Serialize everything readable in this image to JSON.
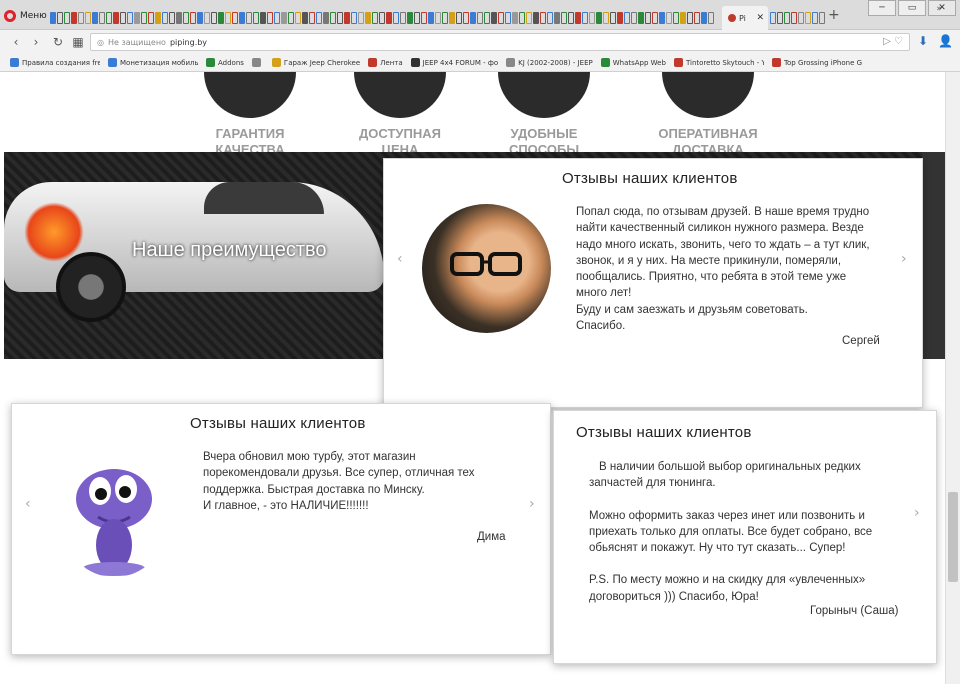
{
  "browser": {
    "menu_label": "Меню",
    "active_tab_label": "Pi",
    "url_security": "Не защищено",
    "url": "piping.by",
    "tab_colors": [
      "#3a7bd5",
      "#5a5a5a",
      "#2a8a3a",
      "#c0392b",
      "#888",
      "#d4a017",
      "#3a7bd5",
      "#777",
      "#2a8a3a",
      "#c0392b",
      "#555",
      "#3a7bd5",
      "#999",
      "#2a8a3a",
      "#c0392b",
      "#d4a017",
      "#3a7bd5",
      "#555",
      "#777",
      "#2a8a3a",
      "#c0392b",
      "#3a7bd5",
      "#999",
      "#555",
      "#2a8a3a",
      "#d4a017",
      "#c0392b",
      "#3a7bd5",
      "#777",
      "#2a8a3a",
      "#555",
      "#c0392b",
      "#3a7bd5",
      "#999",
      "#2a8a3a",
      "#d4a017",
      "#555",
      "#c0392b",
      "#3a7bd5",
      "#777",
      "#2a8a3a",
      "#555",
      "#c0392b",
      "#3a7bd5",
      "#999",
      "#d4a017",
      "#2a8a3a",
      "#555",
      "#c0392b",
      "#3a7bd5",
      "#777",
      "#2a8a3a",
      "#555",
      "#c0392b",
      "#3a7bd5",
      "#999",
      "#2a8a3a",
      "#d4a017",
      "#555",
      "#c0392b",
      "#3a7bd5",
      "#777",
      "#2a8a3a",
      "#555",
      "#c0392b",
      "#3a7bd5",
      "#999",
      "#2a8a3a",
      "#d4a017",
      "#555",
      "#c0392b",
      "#3a7bd5",
      "#777",
      "#2a8a3a",
      "#555",
      "#c0392b",
      "#3a7bd5",
      "#999",
      "#2a8a3a",
      "#d4a017",
      "#555",
      "#c0392b",
      "#3a7bd5",
      "#777",
      "#2a8a3a",
      "#555",
      "#c0392b",
      "#3a7bd5",
      "#999",
      "#2a8a3a",
      "#d4a017",
      "#555",
      "#c0392b",
      "#3a7bd5",
      "#777"
    ]
  },
  "bookmarks": [
    {
      "label": "Правила создания fre",
      "color": "#3a7bd5"
    },
    {
      "label": "Монетизация мобиль",
      "color": "#3a7bd5"
    },
    {
      "label": "Addons",
      "color": "#2a8a3a"
    },
    {
      "label": "",
      "color": "#888"
    },
    {
      "label": "Гараж Jeep Cherokee",
      "color": "#d4a017"
    },
    {
      "label": "Лента",
      "color": "#c0392b"
    },
    {
      "label": "JEEP 4x4 FORUM - фо",
      "color": "#333"
    },
    {
      "label": "KJ (2002-2008) - JEEP",
      "color": "#888"
    },
    {
      "label": "WhatsApp Web",
      "color": "#2a8a3a"
    },
    {
      "label": "Tintoretto Skytouch - Y",
      "color": "#c0392b"
    },
    {
      "label": "Top Grossing iPhone G",
      "color": "#c0392b"
    }
  ],
  "advantages": [
    {
      "line1": "ГАРАНТИЯ",
      "line2": "КАЧЕСТВА"
    },
    {
      "line1": "ДОСТУПНАЯ",
      "line2": "ЦЕНА"
    },
    {
      "line1": "УДОБНЫЕ",
      "line2": "СПОСОБЫ ОПЛАТЫ"
    },
    {
      "line1": "ОПЕРАТИВНАЯ",
      "line2": "ДОСТАВКА"
    }
  ],
  "band_title": "Наше преимущество",
  "reviews": [
    {
      "title": "Отзывы наших клиентов",
      "text": "Попал сюда, по отзывам друзей. В наше время трудно найти качественный силикон нужного размера. Везде надо много искать, звонить, чего то ждать – а тут клик, звонок, и я у них. На месте прикинули, померяли, пообщались. Приятно, что ребята в этой теме уже много лет!",
      "text2": "Буду и сам заезжать и друзьям советовать.",
      "text3": "Спасибо.",
      "author": "Сергей"
    },
    {
      "title": "Отзывы наших клиентов",
      "text": "Вчера обновил мою турбу, этот магазин порекомендовали друзья. Все супер, отличная тех поддержка. Быстрая доставка по Минску.",
      "text2": "И главное, - это НАЛИЧИЕ!!!!!!!",
      "author": "Дима"
    },
    {
      "title": "Отзывы наших клиентов",
      "text": "В наличии большой выбор оригинальных редких запчастей для тюнинга.",
      "text2": "Можно оформить заказ через инет или позвонить и приехать только для оплаты. Все будет собрано, все обьяснят и покажут. Ну что тут сказать... Супер!",
      "text3": "P.S. По месту можно и на скидку для «увлеченных» договориться ))) Спасибо, Юра!",
      "author": "Горыныч (Саша)"
    }
  ],
  "arrows": {
    "prev": "‹",
    "next": "›"
  }
}
